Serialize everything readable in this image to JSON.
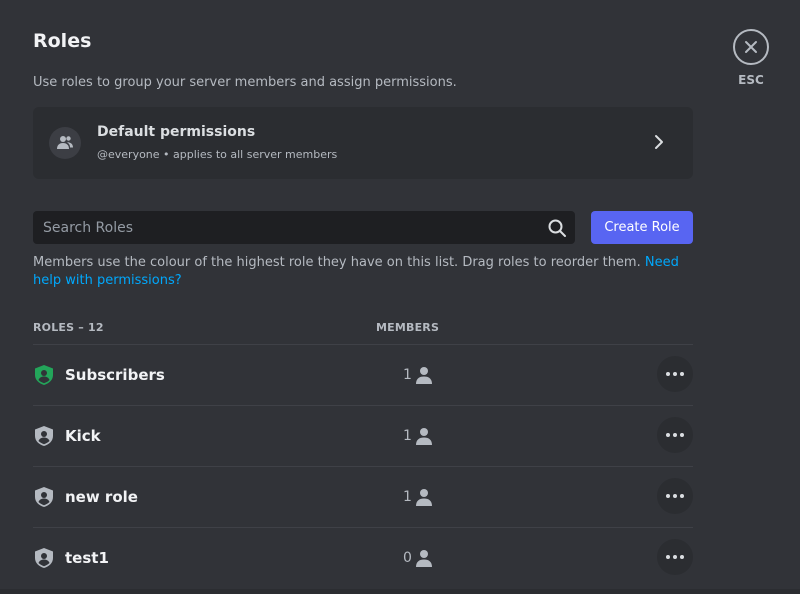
{
  "page": {
    "title": "Roles",
    "description": "Use roles to group your server members and assign permissions."
  },
  "close": {
    "label": "ESC",
    "icon": "close-icon"
  },
  "default_permissions": {
    "title": "Default permissions",
    "subtitle": "@everyone • applies to all server members",
    "icon": "members-icon"
  },
  "search": {
    "placeholder": "Search Roles",
    "value": ""
  },
  "create_role": {
    "label": "Create Role"
  },
  "help": {
    "text": "Members use the colour of the highest role they have on this list. Drag roles to reorder them. ",
    "link": "Need help with permissions?"
  },
  "table": {
    "roles_header": "ROLES – 12",
    "members_header": "MEMBERS",
    "rows": [
      {
        "name": "Subscribers",
        "members": "1",
        "color": "#23a55a"
      },
      {
        "name": "Kick",
        "members": "1",
        "color": "#b5bac1"
      },
      {
        "name": "new role",
        "members": "1",
        "color": "#b5bac1"
      },
      {
        "name": "test1",
        "members": "0",
        "color": "#b5bac1"
      }
    ]
  },
  "colors": {
    "background": "#313338",
    "card": "#2b2d31",
    "accent": "#5865f2",
    "link": "#00a8fc"
  }
}
